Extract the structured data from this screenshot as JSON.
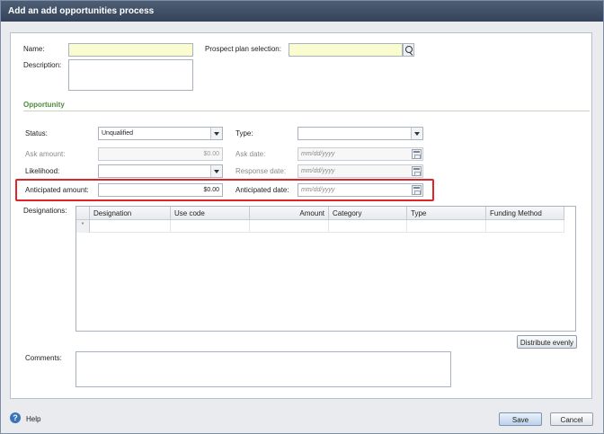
{
  "window": {
    "title": "Add an add opportunities process"
  },
  "form": {
    "name_label": "Name:",
    "name_value": "",
    "description_label": "Description:",
    "prospect_plan_label": "Prospect plan selection:",
    "prospect_plan_value": ""
  },
  "opportunity": {
    "section_title": "Opportunity",
    "status_label": "Status:",
    "status_value": "Unqualified",
    "type_label": "Type:",
    "type_value": "",
    "ask_amount_label": "Ask amount:",
    "ask_amount_value": "$0.00",
    "ask_date_label": "Ask date:",
    "ask_date_placeholder": "mm/dd/yyyy",
    "likelihood_label": "Likelihood:",
    "likelihood_value": "",
    "response_date_label": "Response date:",
    "response_date_placeholder": "mm/dd/yyyy",
    "anticipated_amount_label": "Anticipated amount:",
    "anticipated_amount_value": "$0.00",
    "anticipated_date_label": "Anticipated date:",
    "anticipated_date_placeholder": "mm/dd/yyyy"
  },
  "designations": {
    "label": "Designations:",
    "columns": [
      "Designation",
      "Use code",
      "Amount",
      "Category",
      "Type",
      "Funding Method"
    ],
    "new_row_marker": "*",
    "distribute_button": "Distribute evenly"
  },
  "comments": {
    "label": "Comments:"
  },
  "footer": {
    "help_label": "Help",
    "save_label": "Save",
    "cancel_label": "Cancel"
  },
  "colors": {
    "title_bar": "#3e4e64",
    "section_title": "#4b8b3b",
    "required_field": "#fbfbd0",
    "highlight_border": "#e0242a"
  }
}
